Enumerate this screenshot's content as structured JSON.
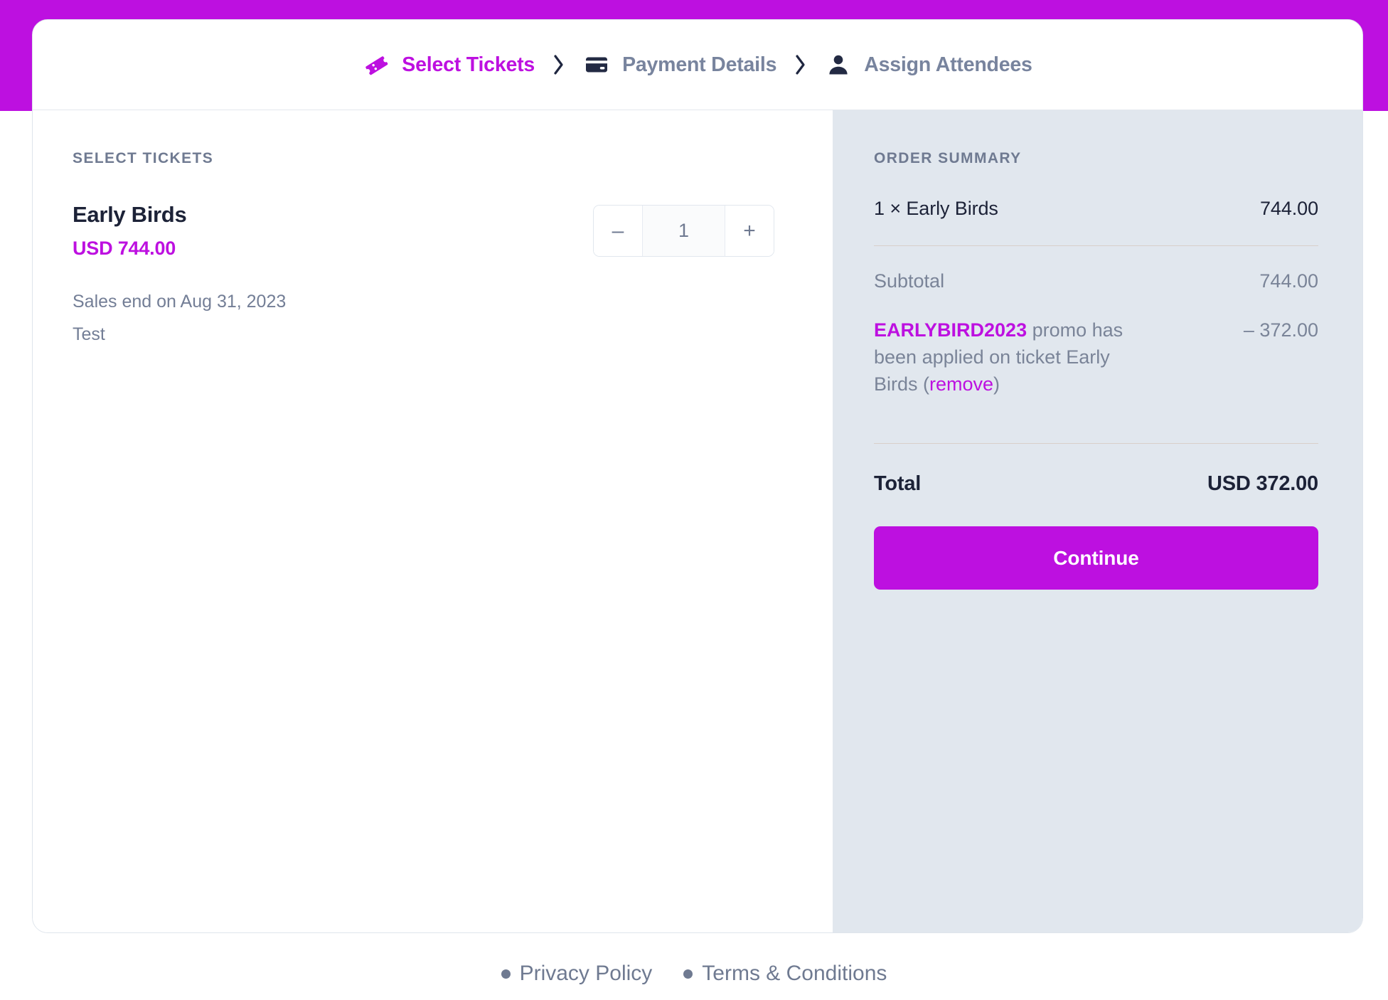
{
  "theme": {
    "brand_color": "#bd10e0",
    "summary_bg": "#e1e7ee",
    "text_dark": "#1c2237",
    "text_muted": "#737e96"
  },
  "steps": [
    {
      "label": "Select Tickets",
      "icon": "ticket-icon",
      "state": "active"
    },
    {
      "label": "Payment Details",
      "icon": "credit-card-icon",
      "state": "inactive"
    },
    {
      "label": "Assign Attendees",
      "icon": "person-icon",
      "state": "inactive"
    }
  ],
  "step_separator": "›",
  "tickets_pane": {
    "heading": "SELECT TICKETS",
    "ticket": {
      "name": "Early Birds",
      "price": "USD 744.00",
      "sales_end": "Sales end on Aug 31, 2023",
      "description": "Test",
      "quantity": "1",
      "decrement_label": "–",
      "increment_label": "+"
    }
  },
  "summary": {
    "heading": "ORDER SUMMARY",
    "line_item": {
      "label": "1 × Early Birds",
      "amount": "744.00"
    },
    "subtotal": {
      "label": "Subtotal",
      "amount": "744.00"
    },
    "promo": {
      "code": "EARLYBIRD2023",
      "text_before": " promo has been applied on ticket Early Birds (",
      "remove_label": "remove",
      "text_after": ")",
      "amount": "– 372.00"
    },
    "total": {
      "label": "Total",
      "amount": "USD 372.00"
    },
    "continue_label": "Continue"
  },
  "footer": {
    "links": [
      {
        "label": "Privacy Policy"
      },
      {
        "label": "Terms & Conditions"
      }
    ]
  }
}
